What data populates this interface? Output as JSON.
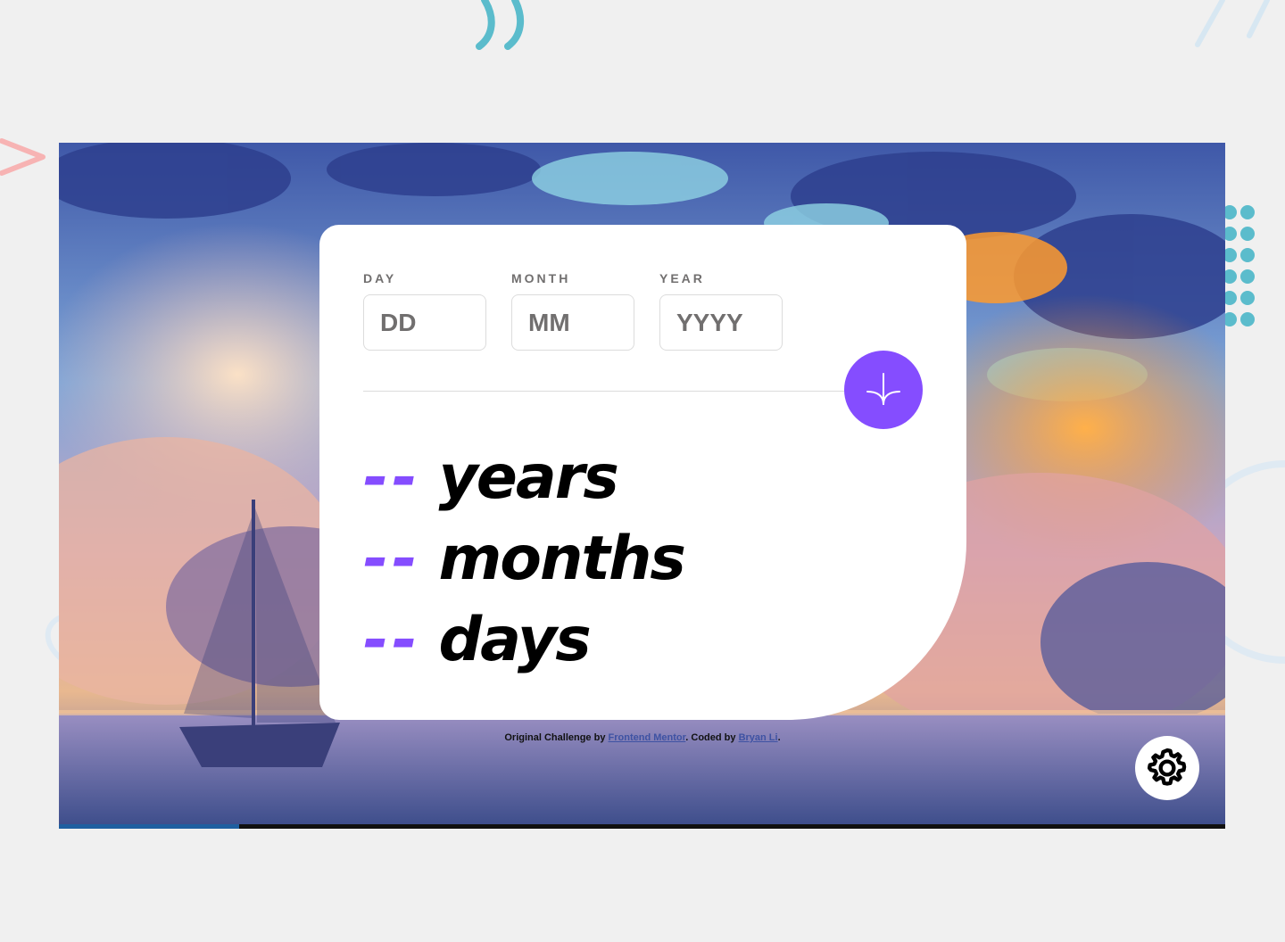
{
  "form": {
    "day": {
      "label": "DAY",
      "placeholder": "DD"
    },
    "month": {
      "label": "MONTH",
      "placeholder": "MM"
    },
    "year": {
      "label": "YEAR",
      "placeholder": "YYYY"
    }
  },
  "submit": {
    "icon": "arrow-down-icon",
    "color": "#854dff"
  },
  "results": [
    {
      "value": "--",
      "unit": "years"
    },
    {
      "value": "--",
      "unit": "months"
    },
    {
      "value": "--",
      "unit": "days"
    }
  ],
  "attribution": {
    "prefix": "Original Challenge by ",
    "link1": "Frontend Mentor",
    "middle": ". Coded by ",
    "link2": "Bryan Li",
    "suffix": "."
  },
  "settings": {
    "icon": "gear-icon"
  },
  "colors": {
    "accent": "#854dff",
    "card": "#ffffff",
    "page": "#f0f0f0"
  }
}
